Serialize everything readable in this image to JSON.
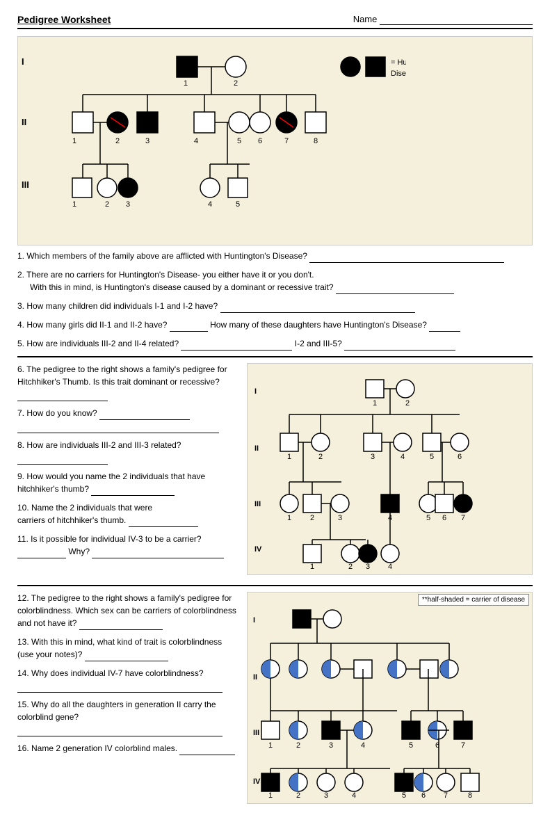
{
  "header": {
    "title": "Pedigree Worksheet",
    "name_label": "Name",
    "name_line": ""
  },
  "section1": {
    "gen_labels": [
      "I",
      "II",
      "III"
    ],
    "legend": {
      "text": "= Huntington's Disease"
    }
  },
  "questions_part1": [
    {
      "number": "1.",
      "text": "Which members of the family above are afflicted with Huntington's Disease?",
      "line_length": "long"
    },
    {
      "number": "2.",
      "text": "There are no carriers for Huntington's Disease- you either have it or you don't.",
      "subtext": "With this in mind, is Huntington's disease caused by a dominant or recessive trait?",
      "line_length": "medium"
    },
    {
      "number": "3.",
      "text": "How many children did individuals I-1 and I-2 have?",
      "line_length": "xl"
    },
    {
      "number": "4.",
      "text": "How many girls did II-1 and II-2 have?",
      "mid_line": true,
      "mid_text": "How many of these daughters have Huntington's Disease?",
      "line_length": "short"
    },
    {
      "number": "5.",
      "text": "How are individuals III-2 and II-4 related?",
      "mid_line": true,
      "mid_text": "I-2 and III-5?",
      "line_length": "medium"
    }
  ],
  "questions_part2_left": [
    {
      "number": "6.",
      "text": "The pedigree to the right shows a family's pedigree for Hitchhiker's Thumb. Is this trait dominant or recessive?"
    },
    {
      "number": "7.",
      "text": "How do you know?"
    },
    {
      "number": "8.",
      "text": "How are individuals III-2 and III-3 related?"
    },
    {
      "number": "9.",
      "text": "How would you name the 2 individuals that have hitchhiker's thumb?"
    },
    {
      "number": "10.",
      "text": "Name the 2 individuals that were carriers of hitchhiker's thumb."
    },
    {
      "number": "11.",
      "text": "Is it possible for individual IV-3 to be a carrier?",
      "mid_text": "Why?"
    }
  ],
  "questions_part3_left": [
    {
      "number": "12.",
      "text": "The pedigree to the right shows a family's pedigree for colorblindness. Which sex can be carriers of colorblindness and not have it?"
    },
    {
      "number": "13.",
      "text": "With this in mind, what kind of trait is colorblindness (use your notes)?"
    },
    {
      "number": "14.",
      "text": "Why does individual IV-7 have colorblindness?"
    },
    {
      "number": "15.",
      "text": "Why do all the daughters in generation II carry the colorblind gene?"
    },
    {
      "number": "16.",
      "text": "Name 2 generation IV colorblind males."
    }
  ]
}
